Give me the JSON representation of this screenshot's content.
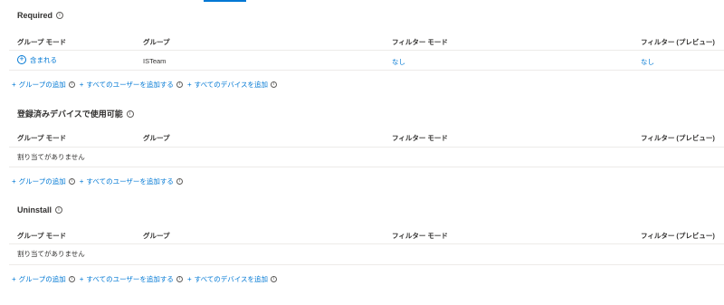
{
  "columns": {
    "group_mode": "グループ モード",
    "group": "グループ",
    "filter_mode": "フィルター モード",
    "filter_preview": "フィルター (プレビュー)"
  },
  "actions": {
    "plus": "+",
    "add_group": "グループの追加",
    "add_all_users": "すべてのユーザーを追加する",
    "add_all_devices": "すべてのデバイスを追加"
  },
  "sections": [
    {
      "title": "Required",
      "rows": [
        {
          "group_mode": "含まれる",
          "group": "ISTeam",
          "filter_mode": "なし",
          "filter_preview": "なし"
        }
      ]
    },
    {
      "title": "登録済みデバイスで使用可能",
      "empty_text": "割り当てがありません"
    },
    {
      "title": "Uninstall",
      "empty_text": "割り当てがありません"
    }
  ],
  "info_glyph": "i",
  "colors": {
    "link": "#0078d4",
    "text": "#323130",
    "separator": "#edebe9"
  }
}
